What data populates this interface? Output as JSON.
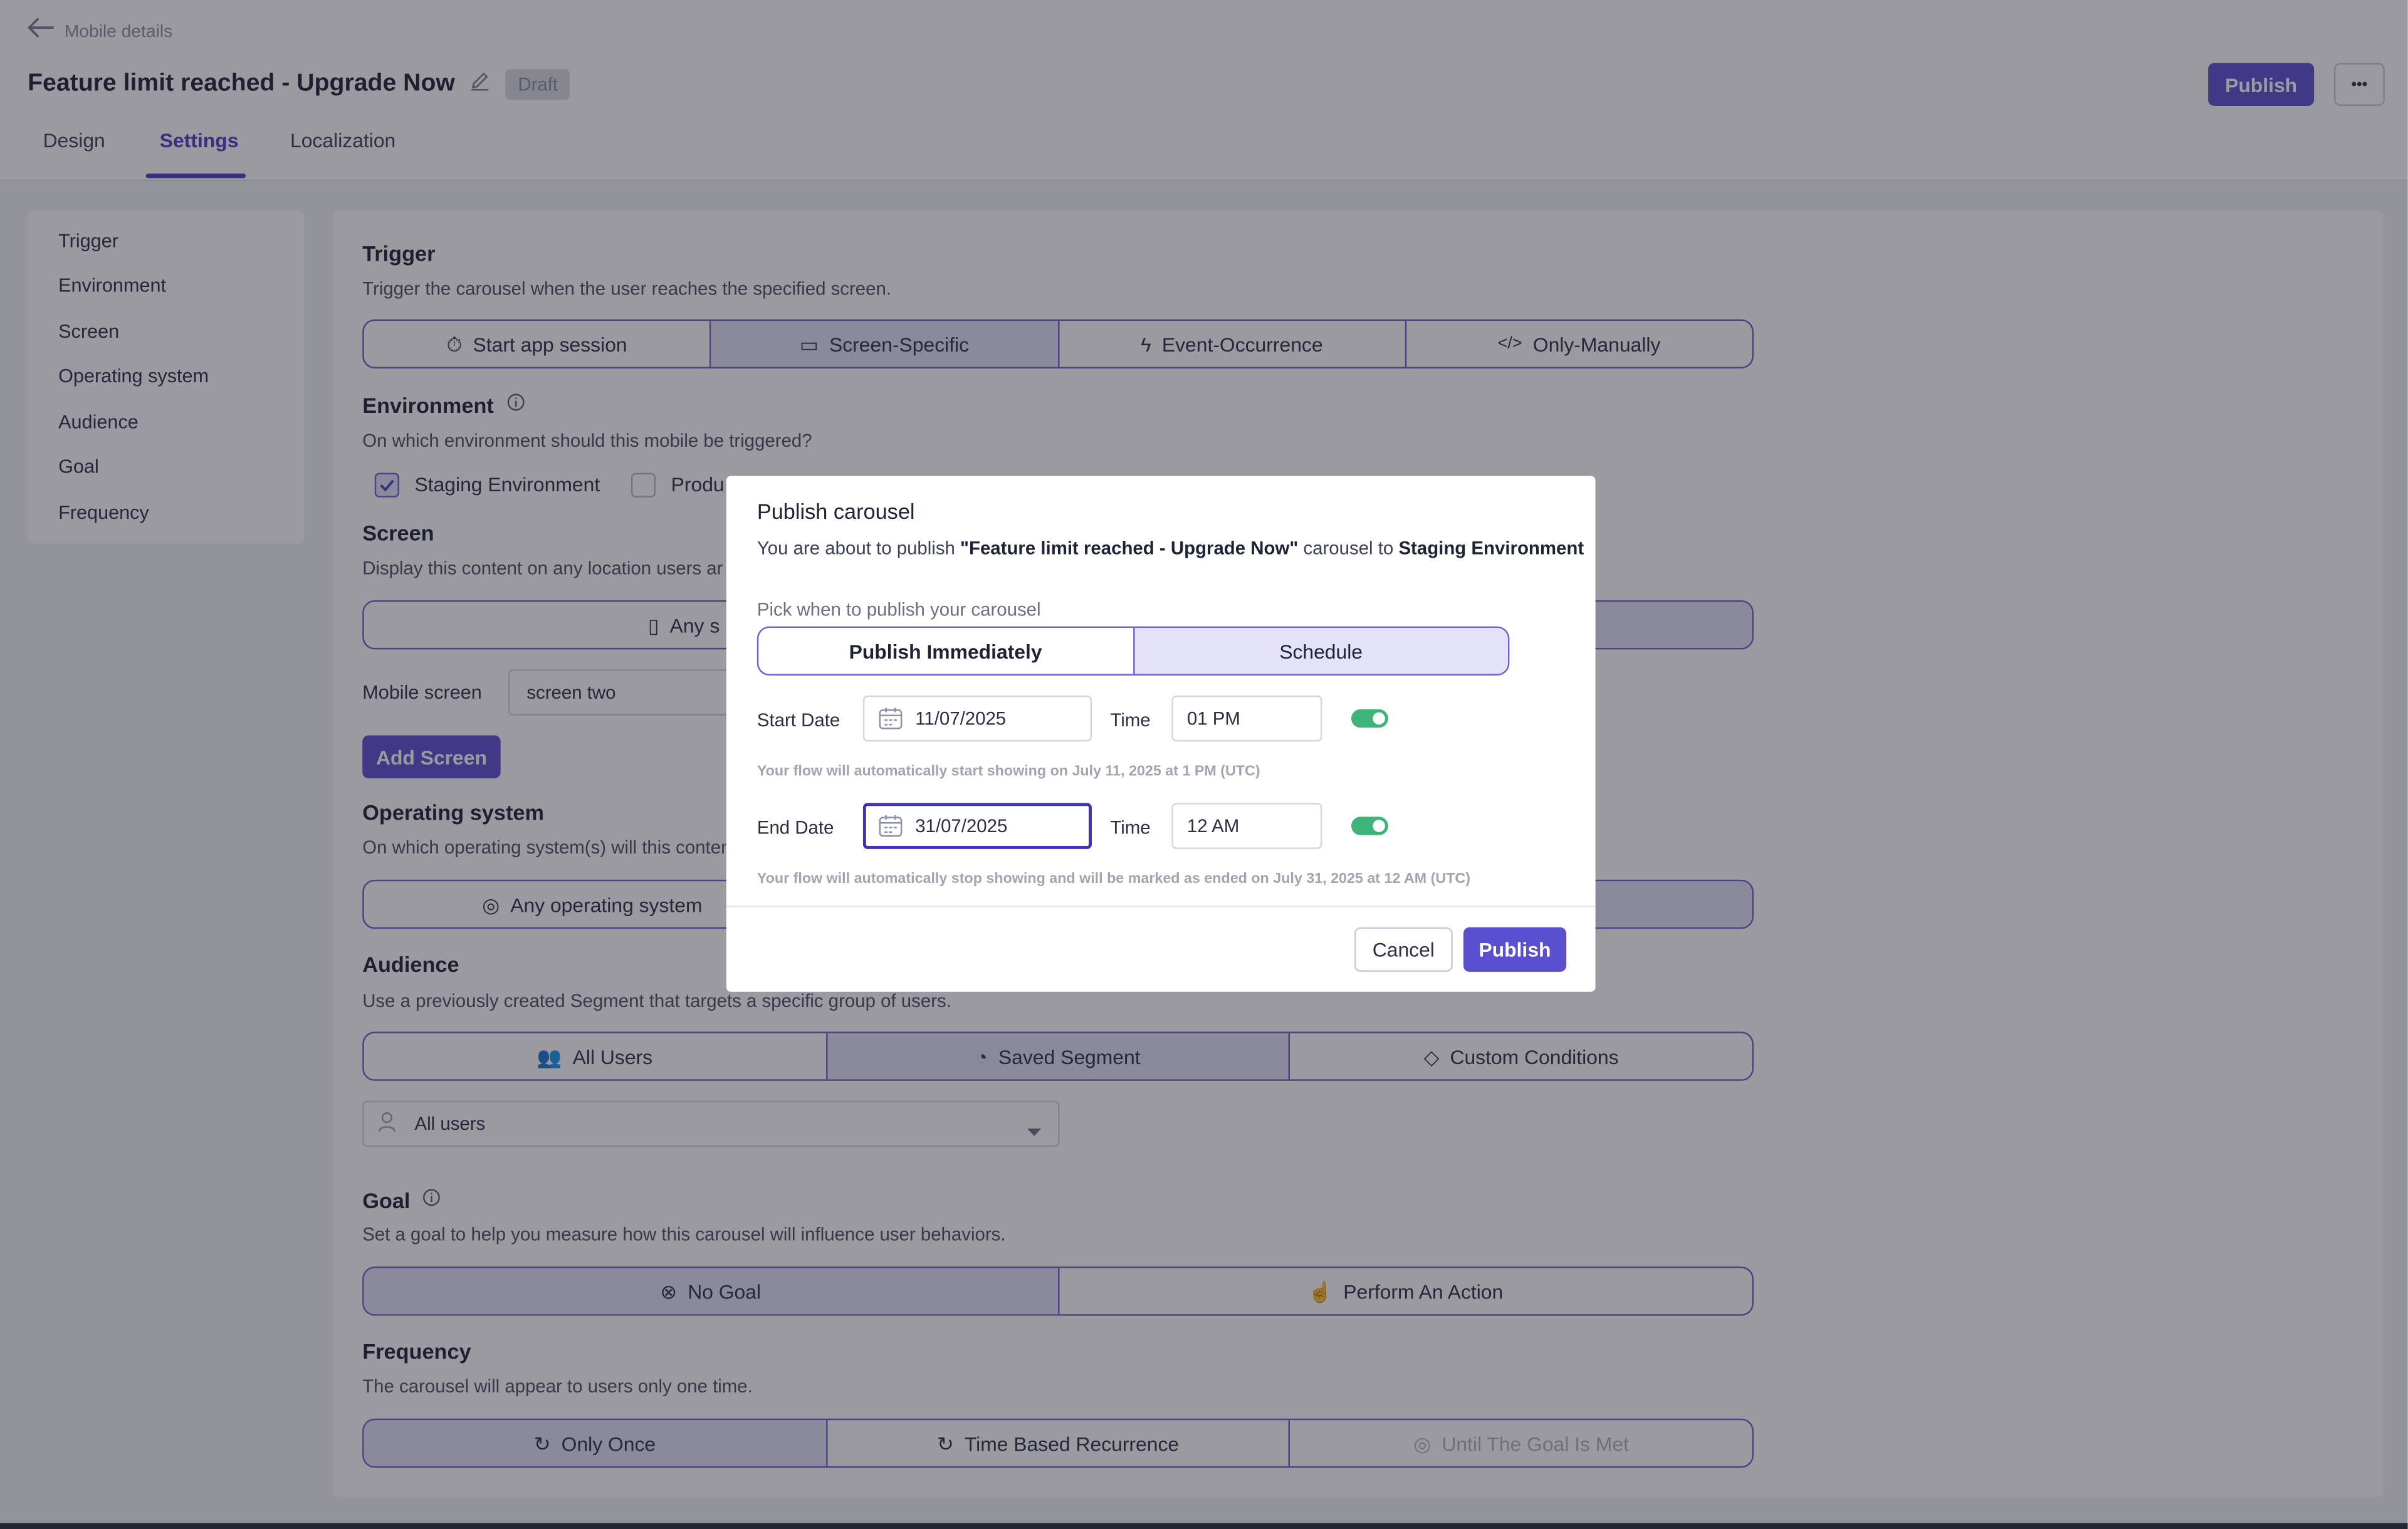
{
  "header": {
    "back_label": "Mobile details",
    "title": "Feature limit reached - Upgrade Now",
    "status_badge": "Draft",
    "publish_label": "Publish",
    "more_label": "•••"
  },
  "tabs": [
    {
      "label": "Design"
    },
    {
      "label": "Settings"
    },
    {
      "label": "Localization"
    }
  ],
  "sidebar": {
    "items": [
      {
        "label": "Trigger"
      },
      {
        "label": "Environment"
      },
      {
        "label": "Screen"
      },
      {
        "label": "Operating system"
      },
      {
        "label": "Audience"
      },
      {
        "label": "Goal"
      },
      {
        "label": "Frequency"
      }
    ]
  },
  "trigger": {
    "title": "Trigger",
    "desc": "Trigger the carousel when the user reaches the specified screen.",
    "options": [
      "Start app session",
      "Screen-Specific",
      "Event-Occurrence",
      "Only-Manually"
    ]
  },
  "environment": {
    "title": "Environment",
    "desc": "On which environment should this mobile be triggered?",
    "staging": "Staging Environment",
    "production": "Produ"
  },
  "screen": {
    "title": "Screen",
    "desc": "Display this content on any location users ar",
    "option_any": "Any s",
    "mobile_screen_label": "Mobile screen",
    "mobile_screen_value": "screen two",
    "add_screen": "Add Screen"
  },
  "os": {
    "title": "Operating system",
    "desc": "On which operating system(s) will this conten",
    "option_any": "Any operating system"
  },
  "audience": {
    "title": "Audience",
    "desc": "Use a previously created Segment that targets a specific group of users.",
    "options": [
      "All Users",
      "Saved Segment",
      "Custom Conditions"
    ],
    "select_value": "All users"
  },
  "goal": {
    "title": "Goal",
    "desc": "Set a goal to help you measure how this carousel will influence user behaviors.",
    "options": [
      "No Goal",
      "Perform An Action"
    ]
  },
  "frequency": {
    "title": "Frequency",
    "desc": "The carousel will appear to users only one time.",
    "options": [
      "Only Once",
      "Time Based Recurrence",
      "Until The Goal Is Met"
    ]
  },
  "modal": {
    "title": "Publish carousel",
    "intro_prefix": "You are about to publish ",
    "intro_name": "\"Feature limit reached - Upgrade Now\"",
    "intro_mid": " carousel to ",
    "intro_env": "Staging Environment",
    "pick_label": "Pick when to publish your carousel",
    "mode_immediate": "Publish Immediately",
    "mode_schedule": "Schedule",
    "start_label": "Start Date",
    "start_date": "11/07/2025",
    "start_time_label": "Time",
    "start_time": "01 PM",
    "start_hint": "Your flow will automatically start showing on July 11, 2025 at 1 PM (UTC)",
    "end_label": "End Date",
    "end_date": "31/07/2025",
    "end_time_label": "Time",
    "end_time": "12 AM",
    "end_hint": "Your flow will automatically stop showing and will be marked as ended on July 31, 2025 at 12 AM (UTC)",
    "cancel": "Cancel",
    "publish": "Publish"
  },
  "colors": {
    "accent": "#5a4fcf",
    "toggle_on": "#3eb37a"
  }
}
